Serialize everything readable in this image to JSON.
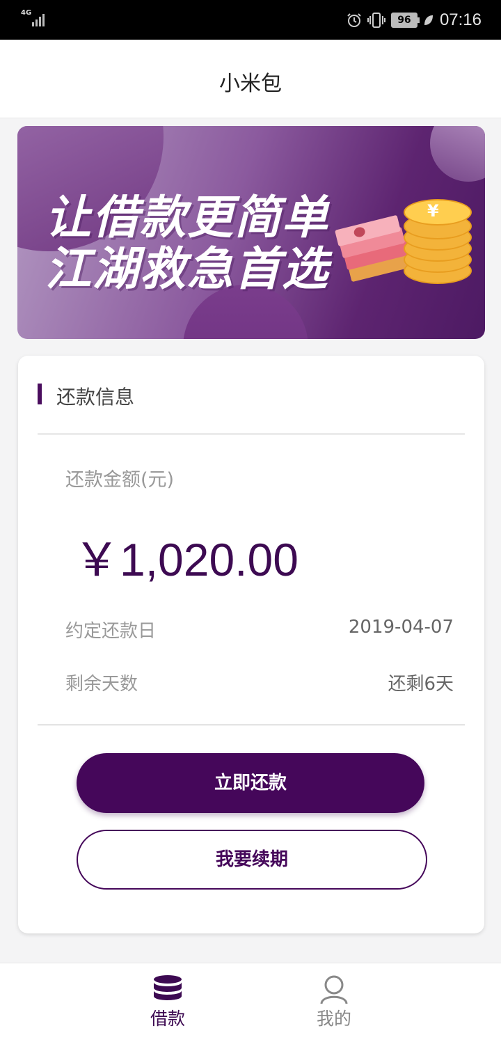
{
  "status_bar": {
    "network": "4G",
    "battery": "96",
    "time": "07:16"
  },
  "header": {
    "title": "小米包"
  },
  "banner": {
    "line1": "让借款更简单",
    "line2": "江湖救急首选"
  },
  "repayment": {
    "section_title": "还款信息",
    "amount_label": "还款金额(元)",
    "amount_value": "￥1,020.00",
    "due_date_label": "约定还款日",
    "due_date_value": "2019-04-07",
    "days_left_label": "剩余天数",
    "days_left_value": "还剩6天",
    "repay_button": "立即还款",
    "renew_button": "我要续期"
  },
  "tab_bar": {
    "tabs": [
      {
        "label": "借款",
        "icon": "database-icon",
        "active": true
      },
      {
        "label": "我的",
        "icon": "user-icon",
        "active": false
      }
    ]
  },
  "colors": {
    "brand": "#45075a",
    "amount_text": "#3d0a52"
  }
}
